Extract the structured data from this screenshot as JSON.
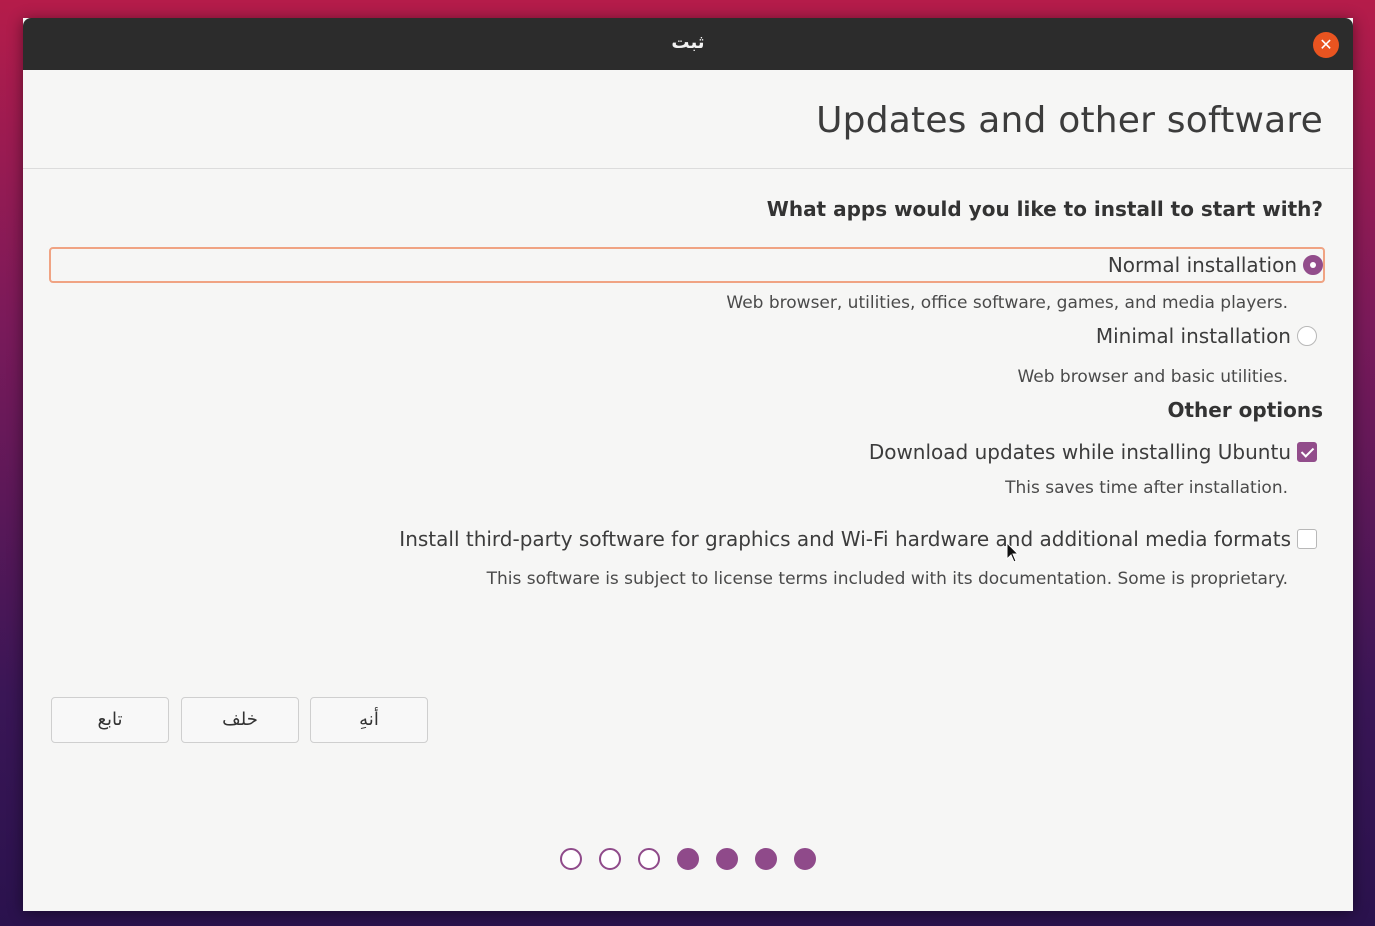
{
  "window": {
    "title": "ثبت",
    "close_icon": "close-icon"
  },
  "page": {
    "title": "Updates and other software"
  },
  "apps_section": {
    "heading": "What apps would you like to install to start with?",
    "options": [
      {
        "label": "Normal installation",
        "description": "Web browser, utilities, office software, games, and media players.",
        "selected": true
      },
      {
        "label": "Minimal installation",
        "description": "Web browser and basic utilities.",
        "selected": false
      }
    ]
  },
  "other_section": {
    "heading": "Other options",
    "options": [
      {
        "label": "Download updates while installing Ubuntu",
        "description": "This saves time after installation.",
        "checked": true
      },
      {
        "label": "Install third-party software for graphics and Wi-Fi hardware and additional media formats",
        "description": "This software is subject to license terms included with its documentation. Some is proprietary.",
        "checked": false
      }
    ]
  },
  "buttons": {
    "continue_label": "تابع",
    "back_label": "خلف",
    "quit_label": "أنهِ"
  },
  "progress": {
    "total_steps": 7,
    "completed_steps": 3
  },
  "colors": {
    "accent": "#924d8b",
    "close": "#e95420",
    "focus_border": "#f0a383",
    "titlebar": "#2c2c2c"
  }
}
